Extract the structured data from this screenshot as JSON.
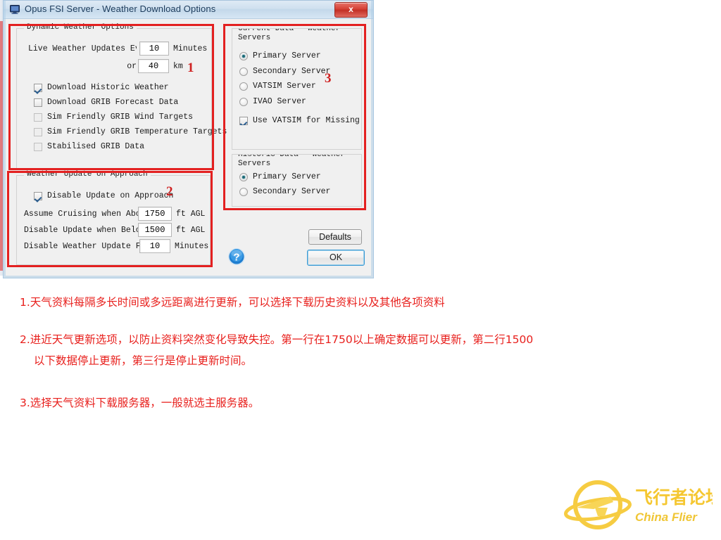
{
  "window": {
    "title": "Opus FSI Server - Weather Download Options",
    "title_icon": "monitor-icon",
    "close_label": "x"
  },
  "dynamic_group": {
    "legend": "Dynamic Weather Options",
    "interval_label": "Live Weather Updates Every",
    "interval_value": "10",
    "interval_unit": "Minutes",
    "or_label": "or",
    "distance_value": "40",
    "distance_unit": "km",
    "checkboxes": [
      {
        "label": "Download Historic Weather",
        "checked": true,
        "enabled": true
      },
      {
        "label": "Download GRIB Forecast Data",
        "checked": false,
        "enabled": true
      },
      {
        "label": "Sim Friendly GRIB Wind Targets",
        "checked": false,
        "enabled": false
      },
      {
        "label": "Sim Friendly GRIB Temperature Targets",
        "checked": false,
        "enabled": false
      },
      {
        "label": "Stabilised GRIB Data",
        "checked": false,
        "enabled": false
      }
    ]
  },
  "approach_group": {
    "legend": "Weather Update on Approach",
    "disable_checkbox": {
      "label": "Disable Update on Approach",
      "checked": true
    },
    "rows": [
      {
        "label": "Assume Cruising when Above",
        "value": "1750",
        "unit": "ft AGL"
      },
      {
        "label": "Disable Update when Below",
        "value": "1500",
        "unit": "ft AGL"
      },
      {
        "label": "Disable Weather Update For",
        "value": "10",
        "unit": "Minutes"
      }
    ]
  },
  "current_data_group": {
    "legend_line1": "Current Data - Weather",
    "legend_line2": "Servers",
    "radios": [
      {
        "label": "Primary Server",
        "selected": true
      },
      {
        "label": "Secondary Server",
        "selected": false
      },
      {
        "label": "VATSIM Server",
        "selected": false
      },
      {
        "label": "IVAO Server",
        "selected": false
      }
    ],
    "vatsim_checkbox": {
      "label": "Use VATSIM for Missing Data",
      "checked": true
    }
  },
  "historic_data_group": {
    "legend_line1": "Historic Data - Weather",
    "legend_line2": "Servers",
    "radios": [
      {
        "label": "Primary Server",
        "selected": true
      },
      {
        "label": "Secondary Server",
        "selected": false
      }
    ]
  },
  "buttons": {
    "defaults": "Defaults",
    "ok": "OK",
    "help_icon": "help-question-icon"
  },
  "markers": {
    "one": "1",
    "two": "2",
    "three": "3"
  },
  "annotations": {
    "line1": "1.天气资料每隔多长时间或多远距离进行更新，可以选择下载历史资料以及其他各项资料",
    "line2a": "2.进近天气更新选项，以防止资料突然变化导致失控。第一行在1750以上确定数据可以更新，第二行1500",
    "line2b": "以下数据停止更新，第三行是停止更新时间。",
    "line3": "3.选择天气资料下载服务器，一般就选主服务器。"
  },
  "watermark": {
    "cn": "飞行者论坛",
    "en": "China Flier",
    "color": "#f5c526"
  },
  "colors": {
    "annotation_red": "#e8201d",
    "marker_red": "#cf2222",
    "box_red": "#e32020",
    "accent_blue": "#3c9ad4"
  }
}
